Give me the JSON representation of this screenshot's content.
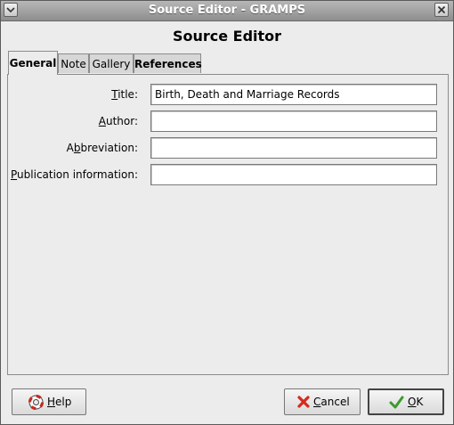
{
  "window": {
    "title": "Source Editor - GRAMPS",
    "heading": "Source Editor"
  },
  "tabs": [
    {
      "label": "General"
    },
    {
      "label": "Note"
    },
    {
      "label": "Gallery"
    },
    {
      "label": "References"
    }
  ],
  "form": {
    "title_label_pre": "",
    "title_label_key": "T",
    "title_label_post": "itle:",
    "title_value": "Birth, Death and Marriage Records",
    "author_label_pre": "",
    "author_label_key": "A",
    "author_label_post": "uthor:",
    "author_value": "",
    "abbrev_label_pre": "A",
    "abbrev_label_key": "b",
    "abbrev_label_post": "breviation:",
    "abbrev_value": "",
    "pub_label_pre": "",
    "pub_label_key": "P",
    "pub_label_post": "ublication information:",
    "pub_value": ""
  },
  "buttons": {
    "help_key": "H",
    "help_rest": "elp",
    "cancel_key": "C",
    "cancel_rest": "ancel",
    "ok_key": "O",
    "ok_rest": "K"
  },
  "icons": {
    "window_menu": "chevron-down-icon",
    "close": "close-icon",
    "help": "lifebuoy-icon",
    "cancel": "red-x-icon",
    "ok": "green-check-icon"
  },
  "colors": {
    "titlebar": "#9e9e9e",
    "background": "#ececec",
    "cancel_icon": "#d42b1f",
    "ok_icon": "#3d9a2e",
    "help_icon": "#c8281e"
  }
}
